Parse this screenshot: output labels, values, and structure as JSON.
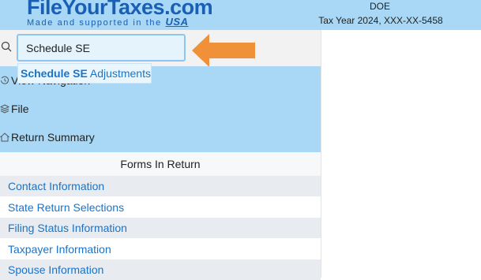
{
  "brand": {
    "logo_main": "FileYourTaxes.com",
    "logo_sub": "Made and supported in the",
    "logo_usa": "USA"
  },
  "header": {
    "user_name": "DOE",
    "tax_year_line": "Tax Year 2024, XXX-XX-5458"
  },
  "search": {
    "value": "Schedule SE",
    "suggestion_bold": "Schedule SE",
    "suggestion_rest": " Adjustments"
  },
  "menu": {
    "items": [
      {
        "label": "View Navigation",
        "icon": "history-icon"
      },
      {
        "label": "File",
        "icon": "layers-icon"
      },
      {
        "label": "Return Summary",
        "icon": "home-icon"
      }
    ]
  },
  "forms": {
    "title": "Forms In Return",
    "items": [
      "Contact Information",
      "State Return Selections",
      "Filing Status Information",
      "Taxpayer Information",
      "Spouse Information"
    ]
  },
  "colors": {
    "header_bg": "#a8d8f5",
    "link": "#1a73c8",
    "arrow": "#f0913a",
    "brand": "#1a5fb4"
  }
}
